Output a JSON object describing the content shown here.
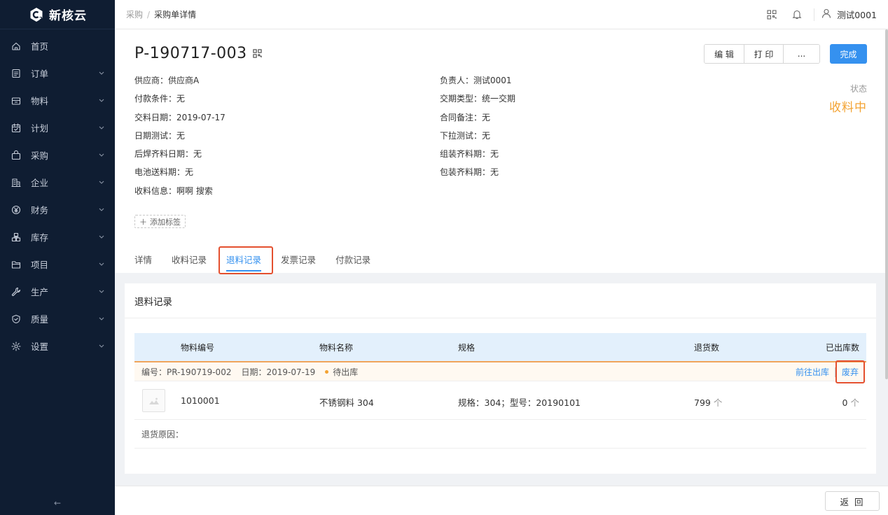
{
  "app": {
    "name": "新核云"
  },
  "sidebar": {
    "items": [
      {
        "label": "首页",
        "icon": "home-icon",
        "expandable": false
      },
      {
        "label": "订单",
        "icon": "order-icon",
        "expandable": true
      },
      {
        "label": "物料",
        "icon": "material-icon",
        "expandable": true
      },
      {
        "label": "计划",
        "icon": "calendar-check-icon",
        "expandable": true
      },
      {
        "label": "采购",
        "icon": "bag-icon",
        "expandable": true
      },
      {
        "label": "企业",
        "icon": "building-icon",
        "expandable": true
      },
      {
        "label": "财务",
        "icon": "yen-icon",
        "expandable": true
      },
      {
        "label": "库存",
        "icon": "warehouse-icon",
        "expandable": true
      },
      {
        "label": "项目",
        "icon": "folder-icon",
        "expandable": true
      },
      {
        "label": "生产",
        "icon": "wrench-icon",
        "expandable": true
      },
      {
        "label": "质量",
        "icon": "shield-check-icon",
        "expandable": true
      },
      {
        "label": "设置",
        "icon": "gear-icon",
        "expandable": true
      }
    ],
    "collapse_label": "←"
  },
  "header": {
    "breadcrumb": [
      "采购",
      "采购单详情"
    ],
    "user_name": "测试0001"
  },
  "order": {
    "number": "P-190717-003",
    "actions": [
      "编 辑",
      "打 印",
      "..."
    ],
    "primary_action": "完成",
    "status_label": "状态",
    "status_value": "收料中",
    "left_fields": [
      "供应商：供应商A",
      "付款条件：无",
      "交料日期：2019-07-17",
      "日期测试：无",
      "后焊齐料日期：无",
      "电池送料期：无",
      "收料信息：啊啊 搜索"
    ],
    "right_fields": [
      "负责人：测试0001",
      "交期类型：统一交期",
      "合同备注：无",
      "下拉测试：无",
      "组装齐料期：无",
      "包装齐料期：无"
    ],
    "add_tag": "添加标签"
  },
  "tabs": [
    "详情",
    "收料记录",
    "退料记录",
    "发票记录",
    "付款记录"
  ],
  "active_tab": 2,
  "returns": {
    "title": "退料记录",
    "columns": [
      "物料编号",
      "物料名称",
      "规格",
      "退货数",
      "已出库数"
    ],
    "group": {
      "code_text": "编号：PR-190719-002",
      "date_text": "日期：2019-07-19",
      "status": "待出库",
      "action_go": "前往出库",
      "action_discard": "废弃"
    },
    "rows": [
      {
        "code": "1010001",
        "name": "不锈钢料 304",
        "spec": "规格：304；型号：20190101",
        "returned": "799",
        "returned_unit": "个",
        "shipped": "0",
        "shipped_unit": "个"
      }
    ],
    "reason_label": "退货原因："
  },
  "footer": {
    "back_label": "返 回"
  },
  "colors": {
    "sidebar_bg": "#0f1d32",
    "primary": "#3591ef",
    "status": "#f3a332",
    "highlight": "#e4502f"
  }
}
